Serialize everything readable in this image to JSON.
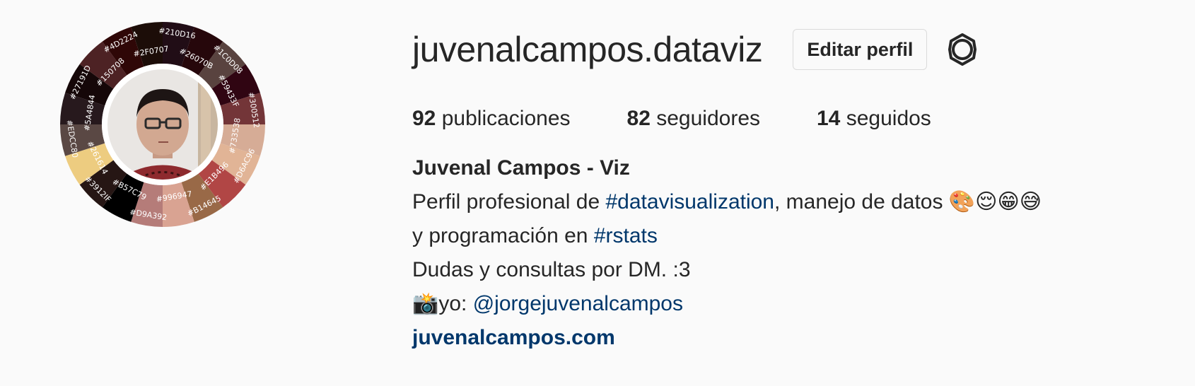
{
  "profile": {
    "username": "juvenalcampos.dataviz",
    "edit_button_label": "Editar perfil",
    "settings_icon": "gear-icon",
    "avatar": {
      "ring_colors": [
        "#210D16",
        "#26070B",
        "#59433F",
        "#300512",
        "#733538",
        "#D6AC96",
        "#E1B496",
        "#B14645",
        "#996947",
        "#D9A392",
        "#B57C79",
        "#3912IF",
        "#261614",
        "#EDCC80",
        "#5A4844",
        "#27191D",
        "#150708",
        "#4D2224",
        "#2F0707",
        "#1C0D08"
      ],
      "ring_labels": [
        "#210D16",
        "#26070B",
        "#1C0D08",
        "#59433F",
        "#300512",
        "#733538",
        "#D6AC96",
        "#E1B496",
        "#B14645",
        "#996947",
        "#D9A392",
        "#B57C79",
        "#3912IF",
        "#261614",
        "#EDCC80",
        "#5A4844",
        "#27191D",
        "#150708",
        "#4D2224",
        "#2F0707"
      ]
    }
  },
  "stats": {
    "posts_count": "92",
    "posts_label": "publicaciones",
    "followers_count": "82",
    "followers_label": "seguidores",
    "following_count": "14",
    "following_label": "seguidos"
  },
  "bio": {
    "name": "Juvenal Campos - Viz",
    "line1_prefix": "Perfil profesional de ",
    "line1_hashtag": "#datavisualization",
    "line1_suffix": ", manejo de datos ",
    "line1_emojis": "🎨😌😁😅",
    "line2_prefix": "y programación en ",
    "line2_hashtag": "#rstats",
    "line3": "Dudas y consultas por DM. :3",
    "line4_emoji": "📸",
    "line4_prefix": "yo: ",
    "line4_mention": "@jorgejuvenalcampos",
    "website": "juvenalcampos.com"
  }
}
